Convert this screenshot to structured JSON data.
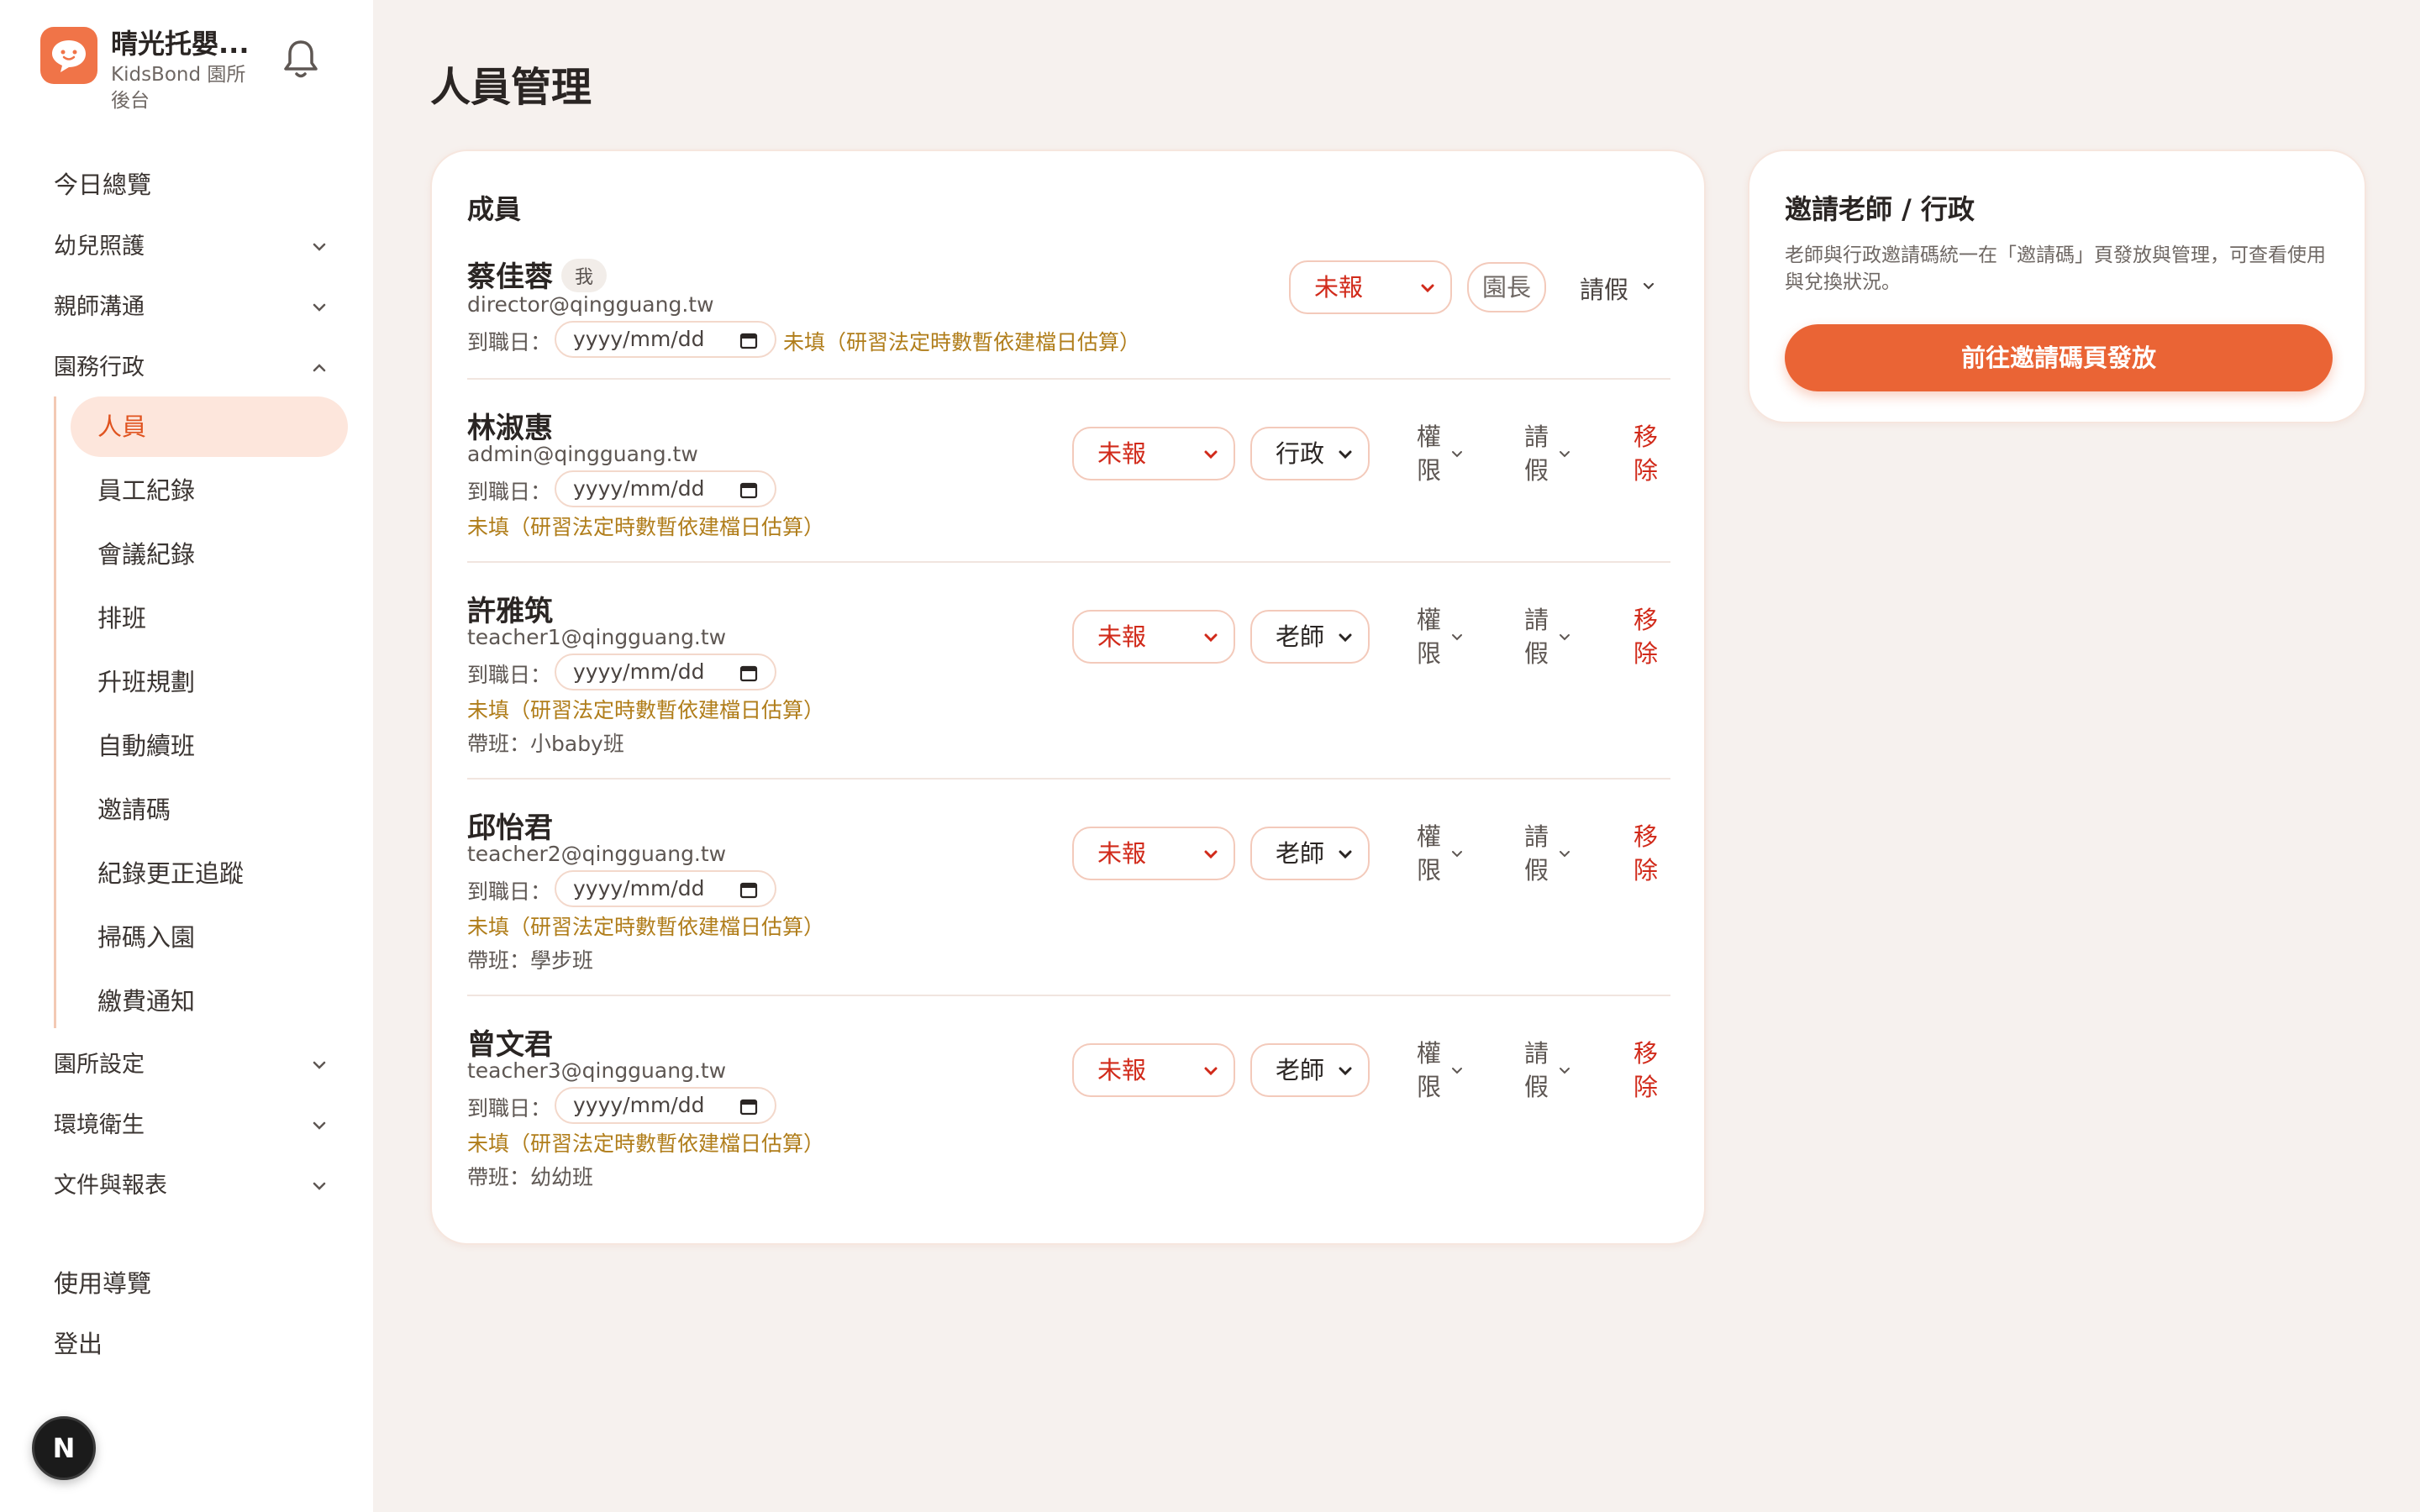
{
  "brand": {
    "title": "晴光托嬰...",
    "subtitle": "KidsBond 園所後台"
  },
  "nav": {
    "today": "今日總覽",
    "infant_care": "幼兒照護",
    "parent_teacher": "親師溝通",
    "admin": "園務行政",
    "sub_items": [
      "人員",
      "員工紀錄",
      "會議紀錄",
      "排班",
      "升班規劃",
      "自動續班",
      "邀請碼",
      "紀錄更正追蹤",
      "掃碼入園",
      "繳費通知"
    ],
    "settings": "園所設定",
    "hygiene": "環境衛生",
    "documents": "文件與報表",
    "guide": "使用導覽",
    "logout": "登出",
    "n_button": "N"
  },
  "page": {
    "title": "人員管理"
  },
  "members": {
    "title": "成員",
    "date_label": "到職日：",
    "date_placeholder": "yyyy/mm/dd",
    "note": "未填（研習法定時數暫依建檔日估算）",
    "status_value": "未報",
    "perm_label": "權限",
    "leave_label": "請假",
    "remove_label": "移除",
    "me_badge": "我",
    "director_role": "園長",
    "list": [
      {
        "name": "蔡佳蓉",
        "email": "director@qingguang.tw",
        "role": "園長",
        "class": ""
      },
      {
        "name": "林淑惠",
        "email": "admin@qingguang.tw",
        "role": "行政",
        "class": ""
      },
      {
        "name": "許雅筑",
        "email": "teacher1@qingguang.tw",
        "role": "老師",
        "class": "帶班：小baby班"
      },
      {
        "name": "邱怡君",
        "email": "teacher2@qingguang.tw",
        "role": "老師",
        "class": "帶班：學步班"
      },
      {
        "name": "曾文君",
        "email": "teacher3@qingguang.tw",
        "role": "老師",
        "class": "帶班：幼幼班"
      }
    ]
  },
  "invite": {
    "title": "邀請老師 / 行政",
    "desc": "老師與行政邀請碼統一在「邀請碼」頁發放與管理，可查看使用與兌換狀況。",
    "button": "前往邀請碼頁發放"
  },
  "colors": {
    "accent": "#ea6435",
    "status_red": "#d12a1a",
    "note_gold": "#b07d1a"
  }
}
